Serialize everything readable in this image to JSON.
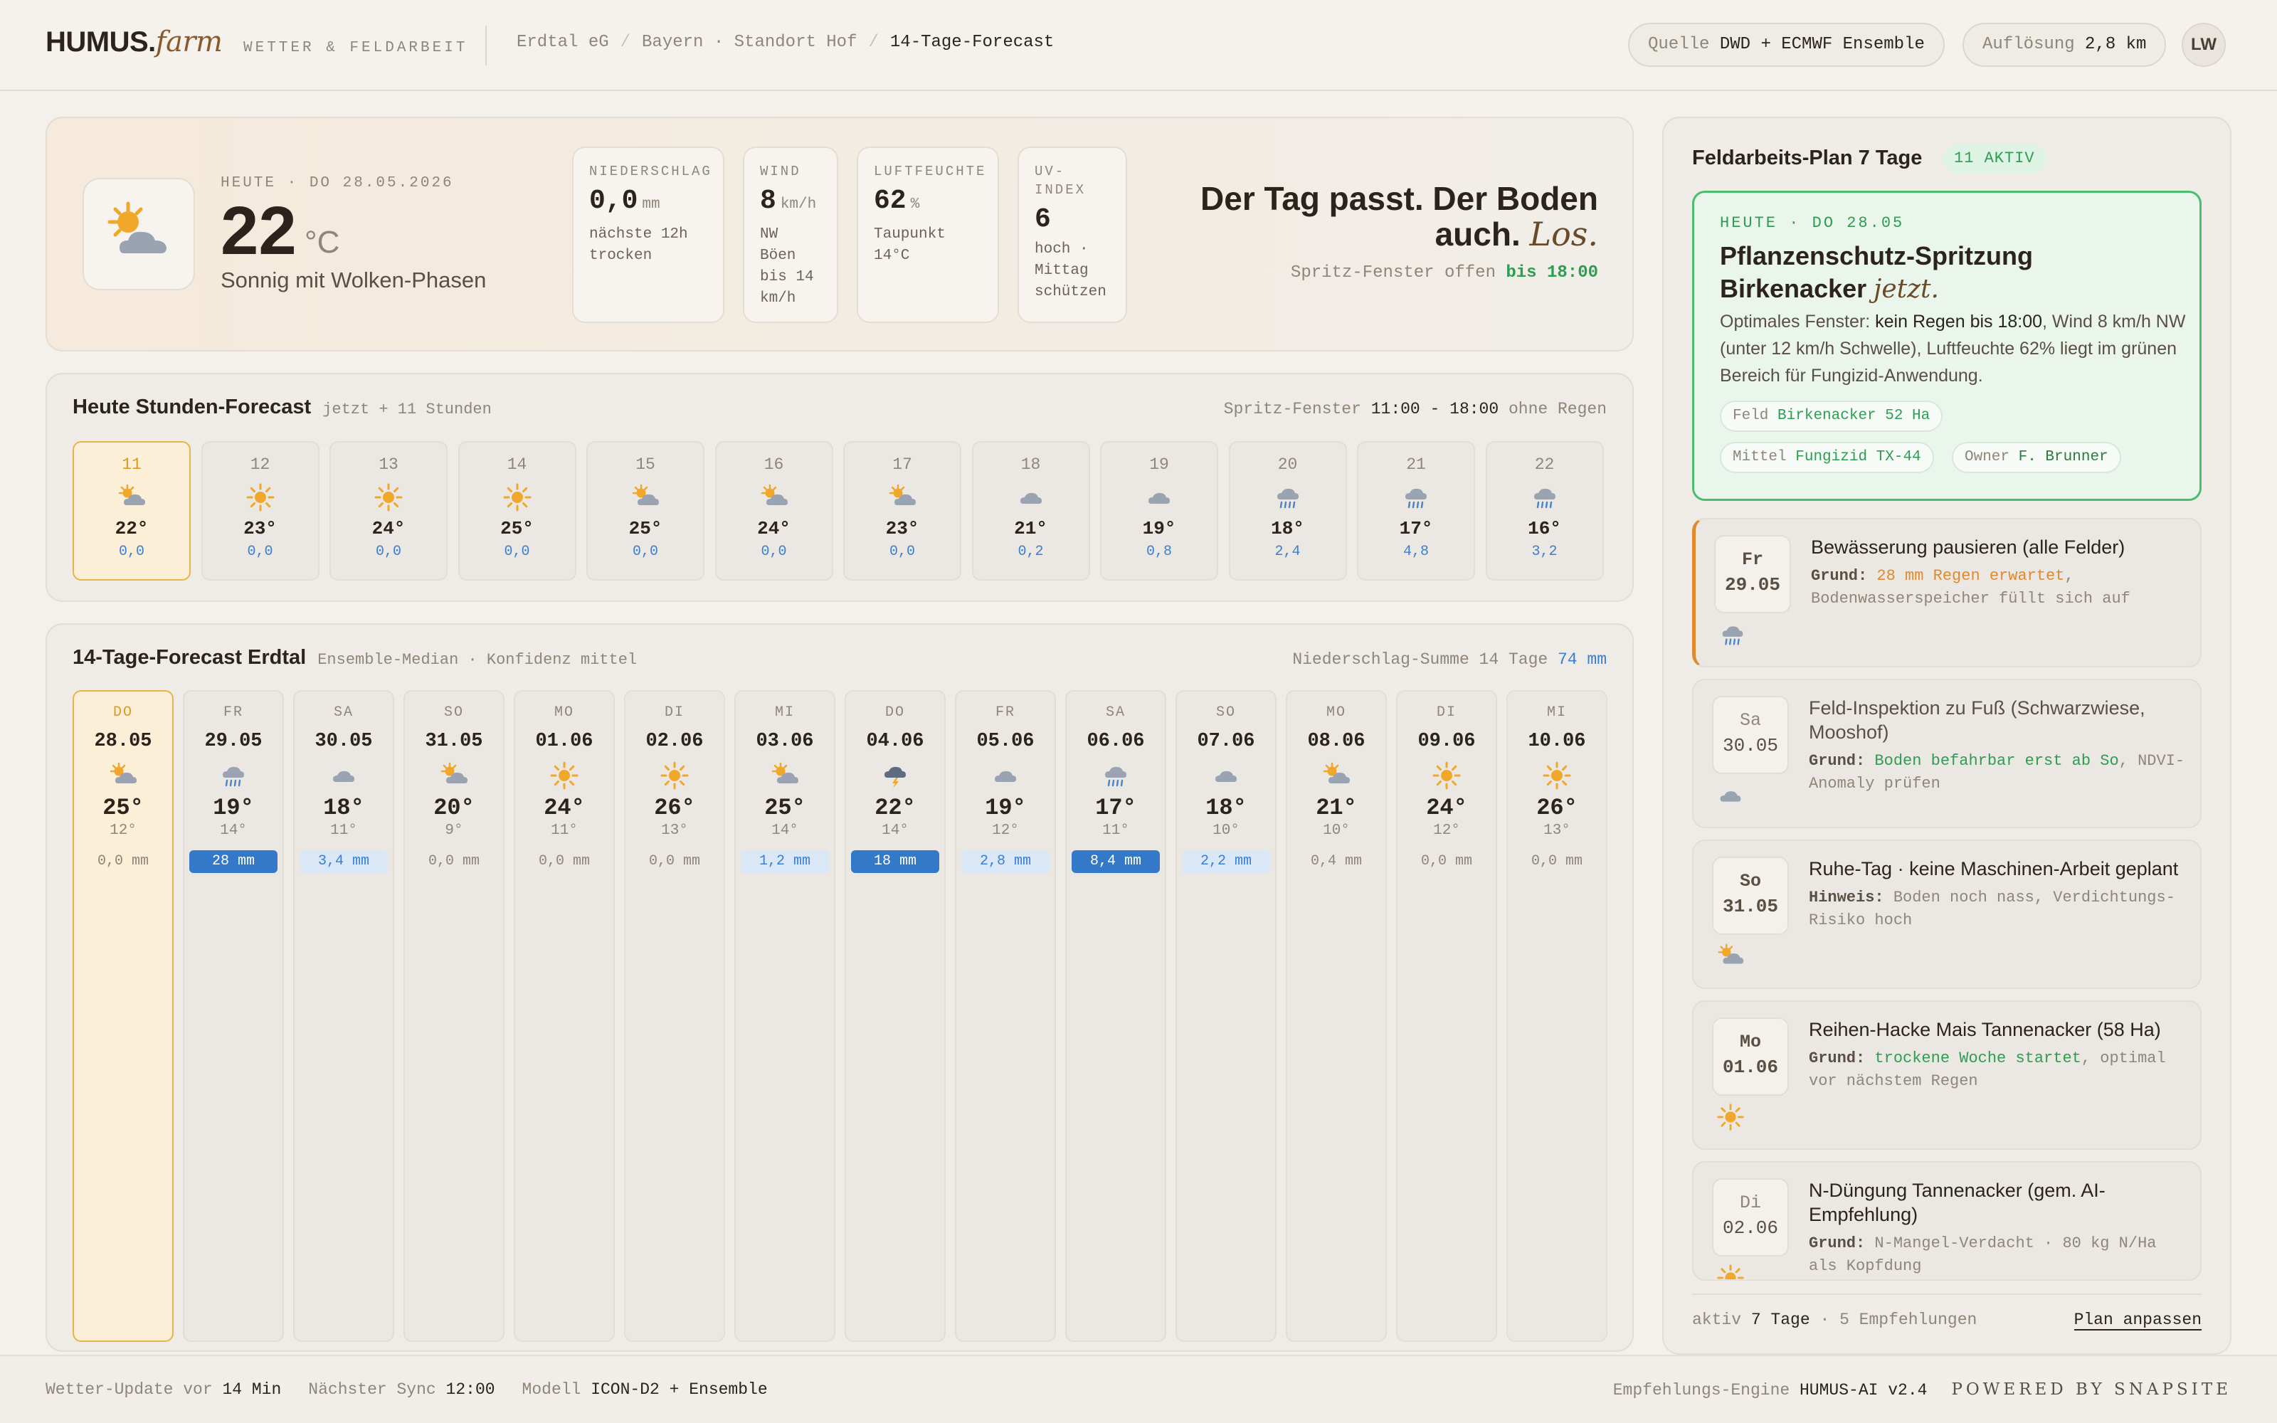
{
  "header": {
    "logo_main": "HUMUS.",
    "logo_farm": "farm",
    "logo_sub": "WETTER & FELDARBEIT",
    "breadcrumbs": [
      "Erdtal eG",
      "Bayern · Standort Hof",
      "14-Tage-Forecast"
    ],
    "source_label": "Quelle",
    "source_value": "DWD + ECMWF Ensemble",
    "resolution_label": "Auflösung",
    "resolution_value": "2,8 km",
    "avatar": "LW"
  },
  "hero": {
    "date": "HEUTE · DO 28.05.2026",
    "temp": "22",
    "unit": "°C",
    "desc": "Sonnig mit Wolken-Phasen",
    "metrics": [
      {
        "label": "NIEDERSCHLAG",
        "value": "0,0",
        "unit": "mm",
        "sub": "nächste 12h trocken"
      },
      {
        "label": "WIND",
        "value": "8",
        "unit": "km/h",
        "sub": "NW Böen bis 14 km/h"
      },
      {
        "label": "LUFTFEUCHTE",
        "value": "62",
        "unit": "%",
        "sub": "Taupunkt 14°C"
      },
      {
        "label": "UV-INDEX",
        "value": "6",
        "unit": "",
        "sub": "hoch · Mittag schützen"
      }
    ],
    "slogan_line1": "Der Tag passt. Der Boden",
    "slogan_line2": "auch.",
    "slogan_it": "Los.",
    "window_text": "Spritz-Fenster offen",
    "window_value": "bis 18:00",
    "icon": "sun-cloud-icon"
  },
  "hourly": {
    "title": "Heute Stunden-Forecast",
    "subtitle": "jetzt + 11 Stunden",
    "right_label": "Spritz-Fenster",
    "right_value": "11:00 - 18:00",
    "right_suffix": "ohne Regen",
    "hours": [
      {
        "h": "11",
        "icon": "partly",
        "t": "22°",
        "p": "0,0"
      },
      {
        "h": "12",
        "icon": "sun",
        "t": "23°",
        "p": "0,0"
      },
      {
        "h": "13",
        "icon": "sun",
        "t": "24°",
        "p": "0,0"
      },
      {
        "h": "14",
        "icon": "sun",
        "t": "25°",
        "p": "0,0"
      },
      {
        "h": "15",
        "icon": "partly",
        "t": "25°",
        "p": "0,0"
      },
      {
        "h": "16",
        "icon": "partly",
        "t": "24°",
        "p": "0,0"
      },
      {
        "h": "17",
        "icon": "partly",
        "t": "23°",
        "p": "0,0"
      },
      {
        "h": "18",
        "icon": "cloud",
        "t": "21°",
        "p": "0,2"
      },
      {
        "h": "19",
        "icon": "cloud",
        "t": "19°",
        "p": "0,8"
      },
      {
        "h": "20",
        "icon": "rain",
        "t": "18°",
        "p": "2,4"
      },
      {
        "h": "21",
        "icon": "rain",
        "t": "17°",
        "p": "4,8"
      },
      {
        "h": "22",
        "icon": "rain",
        "t": "16°",
        "p": "3,2"
      }
    ]
  },
  "daily": {
    "title": "14-Tage-Forecast Erdtal",
    "subtitle": "Ensemble-Median · Konfidenz mittel",
    "right_label": "Niederschlag-Summe 14 Tage",
    "right_value": "74 mm",
    "days": [
      {
        "dw": "DO",
        "dd": "28.05",
        "icon": "partly",
        "hi": "25°",
        "lo": "12°",
        "rain": "0,0 mm",
        "level": "none"
      },
      {
        "dw": "FR",
        "dd": "29.05",
        "icon": "rain",
        "hi": "19°",
        "lo": "14°",
        "rain": "28 mm",
        "level": "heavy"
      },
      {
        "dw": "SA",
        "dd": "30.05",
        "icon": "cloud",
        "hi": "18°",
        "lo": "11°",
        "rain": "3,4 mm",
        "level": "light"
      },
      {
        "dw": "SO",
        "dd": "31.05",
        "icon": "partly",
        "hi": "20°",
        "lo": "9°",
        "rain": "0,0 mm",
        "level": "none"
      },
      {
        "dw": "MO",
        "dd": "01.06",
        "icon": "sun",
        "hi": "24°",
        "lo": "11°",
        "rain": "0,0 mm",
        "level": "none"
      },
      {
        "dw": "DI",
        "dd": "02.06",
        "icon": "sun",
        "hi": "26°",
        "lo": "13°",
        "rain": "0,0 mm",
        "level": "none"
      },
      {
        "dw": "MI",
        "dd": "03.06",
        "icon": "partly",
        "hi": "25°",
        "lo": "14°",
        "rain": "1,2 mm",
        "level": "light"
      },
      {
        "dw": "DO",
        "dd": "04.06",
        "icon": "storm",
        "hi": "22°",
        "lo": "14°",
        "rain": "18 mm",
        "level": "heavy"
      },
      {
        "dw": "FR",
        "dd": "05.06",
        "icon": "cloud",
        "hi": "19°",
        "lo": "12°",
        "rain": "2,8 mm",
        "level": "light"
      },
      {
        "dw": "SA",
        "dd": "06.06",
        "icon": "rain",
        "hi": "17°",
        "lo": "11°",
        "rain": "8,4 mm",
        "level": "heavy"
      },
      {
        "dw": "SO",
        "dd": "07.06",
        "icon": "cloud",
        "hi": "18°",
        "lo": "10°",
        "rain": "2,2 mm",
        "level": "light"
      },
      {
        "dw": "MO",
        "dd": "08.06",
        "icon": "partly",
        "hi": "21°",
        "lo": "10°",
        "rain": "0,4 mm",
        "level": "none"
      },
      {
        "dw": "DI",
        "dd": "09.06",
        "icon": "sun",
        "hi": "24°",
        "lo": "12°",
        "rain": "0,0 mm",
        "level": "none"
      },
      {
        "dw": "MI",
        "dd": "10.06",
        "icon": "sun",
        "hi": "26°",
        "lo": "13°",
        "rain": "0,0 mm",
        "level": "none"
      }
    ]
  },
  "plan": {
    "title": "Feldarbeits-Plan 7 Tage",
    "badge": "11 AKTIV",
    "featured": {
      "kicker": "HEUTE · DO 28.05",
      "title": "Pflanzenschutz-Spritzung Birkenacker",
      "title_it": "jetzt.",
      "desc_pre": "Optimales Fenster:",
      "desc_bold": "kein Regen bis 18:00",
      "desc_post": ", Wind 8 km/h NW (unter 12 km/h Schwelle), Luftfeuchte 62% liegt im grünen Bereich für Fungizid-Anwendung.",
      "chips": [
        {
          "k": "Feld",
          "v": "Birkenacker 52 Ha"
        },
        {
          "k": "Mittel",
          "v": "Fungizid TX-44"
        },
        {
          "k": "Owner",
          "v": "F. Brunner"
        }
      ]
    },
    "items": [
      {
        "day": "Fr",
        "date": "29.05",
        "title": "Bewässerung pausieren (alle Felder)",
        "label": "Grund:",
        "hl": "28 mm Regen erwartet",
        "rest": ", Bodenwasserspeicher füllt sich auf",
        "hlclass": "o",
        "icon": "rain"
      },
      {
        "day": "Sa",
        "date": "30.05",
        "title": "Feld-Inspektion zu Fuß (Schwarzwiese, Mooshof)",
        "label": "Grund:",
        "hl": "Boden befahrbar erst ab So",
        "rest": ", NDVI-Anomaly prüfen",
        "hlclass": "g",
        "icon": "cloud"
      },
      {
        "day": "So",
        "date": "31.05",
        "title": "Ruhe-Tag · keine Maschinen-Arbeit geplant",
        "label": "Hinweis:",
        "hl": "",
        "rest": "Boden noch nass, Verdichtungs-Risiko hoch",
        "hlclass": "",
        "icon": "partly"
      },
      {
        "day": "Mo",
        "date": "01.06",
        "title": "Reihen-Hacke Mais Tannenacker (58 Ha)",
        "label": "Grund:",
        "hl": "trockene Woche startet",
        "rest": ", optimal vor nächstem Regen",
        "hlclass": "g",
        "icon": "sun"
      },
      {
        "day": "Di",
        "date": "02.06",
        "title": "N-Düngung Tannenacker (gem. AI-Empfehlung)",
        "label": "Grund:",
        "hl": "",
        "rest": "N-Mangel-Verdacht · 80 kg N/Ha als Kopfdung",
        "hlclass": "",
        "icon": "sun"
      }
    ],
    "footer_pre": "aktiv",
    "footer_val": "7 Tage",
    "footer_post": "· 5 Empfehlungen",
    "footer_link": "Plan anpassen"
  },
  "footer": {
    "update_label": "Wetter-Update vor",
    "update_value": "14 Min",
    "sync_label": "Nächster Sync",
    "sync_value": "12:00",
    "model_label": "Modell",
    "model_value": "ICON-D2 + Ensemble",
    "engine_label": "Empfehlungs-Engine",
    "engine_value": "HUMUS-AI v2.4",
    "powered": "POWERED BY SNAPSITE"
  },
  "colors": {
    "accent_green": "#2e9d52",
    "rain_blue": "#3478c8",
    "sun": "#f0a72a",
    "today": "#e9b34a"
  }
}
